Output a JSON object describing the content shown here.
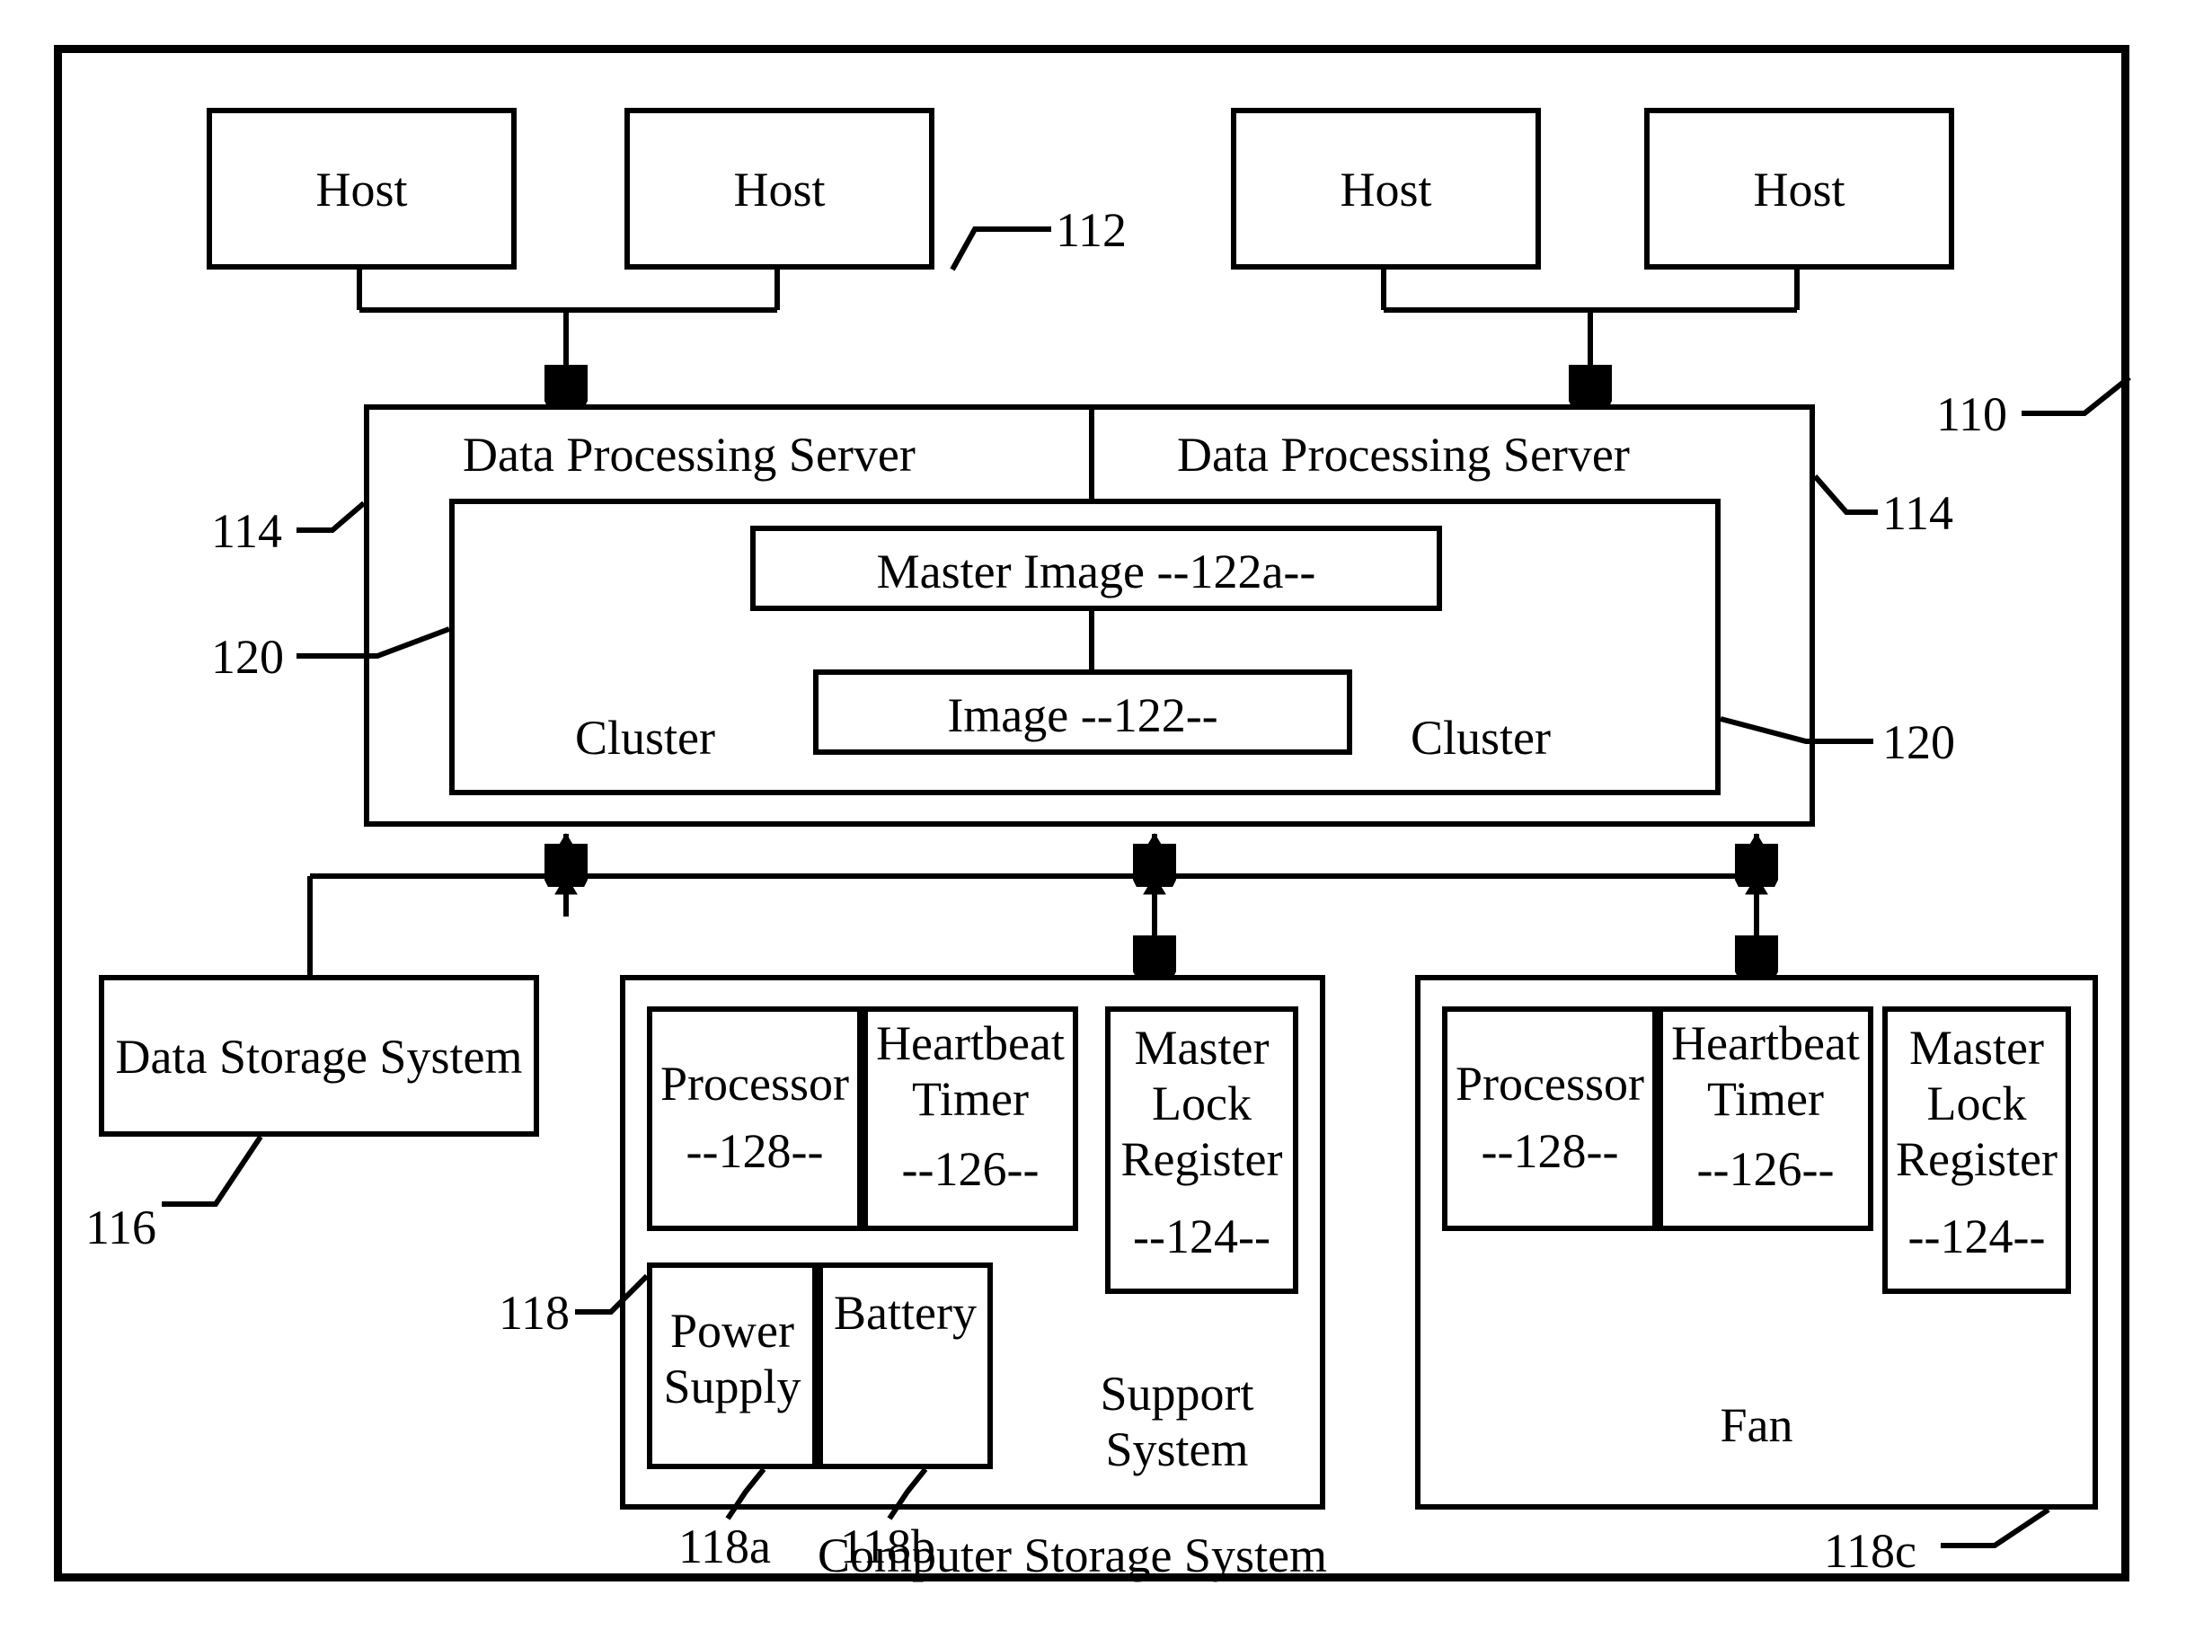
{
  "hosts": {
    "h1": "Host",
    "h2": "Host",
    "h3": "Host",
    "h4": "Host"
  },
  "servers": {
    "left": "Data Processing Server",
    "right": "Data Processing Server"
  },
  "cluster": {
    "left": "Cluster",
    "right": "Cluster",
    "master_image": "Master Image   --122a--",
    "image": "Image   --122--"
  },
  "storage": {
    "label": "Data Storage System"
  },
  "support": {
    "processor": {
      "name": "Processor",
      "id": "--128--"
    },
    "heartbeat": {
      "name": "Heartbeat Timer",
      "id": "--126--"
    },
    "master_lock": {
      "name": "Master Lock Register",
      "id": "--124--"
    },
    "power": {
      "name": "Power Supply"
    },
    "battery": {
      "name": "Battery"
    },
    "label": "Support System"
  },
  "fan": {
    "processor": {
      "name": "Processor",
      "id": "--128--"
    },
    "heartbeat": {
      "name": "Heartbeat Timer",
      "id": "--126--"
    },
    "master_lock": {
      "name": "Master Lock Register",
      "id": "--124--"
    },
    "label": "Fan"
  },
  "caption": "Computer Storage System",
  "refs": {
    "r110": "110",
    "r112": "112",
    "r114a": "114",
    "r114b": "114",
    "r120a": "120",
    "r120b": "120",
    "r116": "116",
    "r118": "118",
    "r118a": "118a",
    "r118b": "118b",
    "r118c": "118c"
  }
}
